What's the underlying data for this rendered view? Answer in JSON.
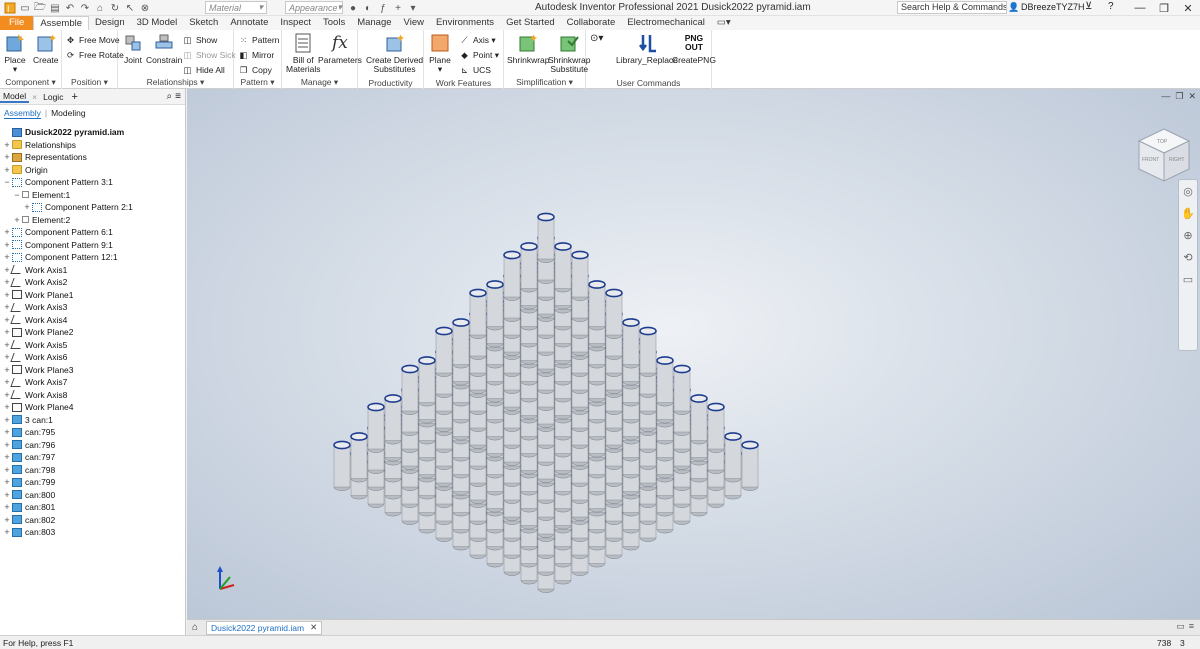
{
  "app": {
    "title": "Autodesk Inventor Professional 2021   Dusick2022 pyramid.iam",
    "search_placeholder": "Search Help & Commands...",
    "user": "DBreezeTYZ7H",
    "material_placeholder": "Material",
    "appearance_placeholder": "Appearance"
  },
  "ribbon_tabs": [
    "File",
    "Assemble",
    "Design",
    "3D Model",
    "Sketch",
    "Annotate",
    "Inspect",
    "Tools",
    "Manage",
    "View",
    "Environments",
    "Get Started",
    "Collaborate",
    "Electromechanical"
  ],
  "ribbon": {
    "component": {
      "title": "Component",
      "place": "Place",
      "create": "Create"
    },
    "position": {
      "title": "Position",
      "free_move": "Free Move",
      "free_rotate": "Free Rotate"
    },
    "relationships": {
      "title": "Relationships",
      "joint": "Joint",
      "constrain": "Constrain",
      "show": "Show",
      "show_sick": "Show Sick",
      "hide_all": "Hide All"
    },
    "pattern": {
      "title": "Pattern",
      "pattern": "Pattern",
      "mirror": "Mirror",
      "copy": "Copy"
    },
    "manage": {
      "title": "Manage",
      "bom_line1": "Bill of",
      "bom_line2": "Materials",
      "parameters": "Parameters"
    },
    "productivity": {
      "title": "Productivity",
      "cds_line1": "Create Derived",
      "cds_line2": "Substitutes"
    },
    "work_features": {
      "title": "Work Features",
      "plane": "Plane",
      "axis": "Axis",
      "point": "Point",
      "ucs": "UCS"
    },
    "simplification": {
      "title": "Simplification",
      "shrinkwrap": "Shrinkwrap",
      "sws_line1": "Shrinkwrap",
      "sws_line2": "Substitute"
    },
    "user_commands": {
      "title": "User Commands",
      "library_replace": "Library_Replace",
      "create_png": "CreatePNG",
      "png_icon_line1": "PNG",
      "png_icon_line2": "OUT"
    }
  },
  "browser": {
    "tabs": [
      "Model",
      "Logic"
    ],
    "subtabs": [
      "Assembly",
      "Modeling"
    ],
    "tree": [
      {
        "label": "Dusick2022 pyramid.iam",
        "icon": "assembly-icon",
        "level": 0,
        "exp": ""
      },
      {
        "label": "Relationships",
        "icon": "folder-icon",
        "level": 0,
        "exp": "+"
      },
      {
        "label": "Representations",
        "icon": "representations-icon",
        "level": 0,
        "exp": "+"
      },
      {
        "label": "Origin",
        "icon": "folder-icon",
        "level": 0,
        "exp": "+"
      },
      {
        "label": "Component Pattern 3:1",
        "icon": "pattern-icon",
        "level": 0,
        "exp": "−"
      },
      {
        "label": "Element:1",
        "icon": "element-icon",
        "level": 1,
        "exp": "−"
      },
      {
        "label": "Component Pattern 2:1",
        "icon": "pattern-icon",
        "level": 2,
        "exp": "+"
      },
      {
        "label": "Element:2",
        "icon": "element-icon",
        "level": 1,
        "exp": "+"
      },
      {
        "label": "Component Pattern 6:1",
        "icon": "pattern-icon",
        "level": 0,
        "exp": "+"
      },
      {
        "label": "Component Pattern 9:1",
        "icon": "pattern-icon",
        "level": 0,
        "exp": "+"
      },
      {
        "label": "Component Pattern 12:1",
        "icon": "pattern-icon",
        "level": 0,
        "exp": "+"
      },
      {
        "label": "Work Axis1",
        "icon": "work-axis-icon",
        "level": 0,
        "exp": "+"
      },
      {
        "label": "Work Axis2",
        "icon": "work-axis-icon",
        "level": 0,
        "exp": "+"
      },
      {
        "label": "Work Plane1",
        "icon": "work-plane-icon",
        "level": 0,
        "exp": "+"
      },
      {
        "label": "Work Axis3",
        "icon": "work-axis-icon",
        "level": 0,
        "exp": "+"
      },
      {
        "label": "Work Axis4",
        "icon": "work-axis-icon",
        "level": 0,
        "exp": "+"
      },
      {
        "label": "Work Plane2",
        "icon": "work-plane-icon",
        "level": 0,
        "exp": "+"
      },
      {
        "label": "Work Axis5",
        "icon": "work-axis-icon",
        "level": 0,
        "exp": "+"
      },
      {
        "label": "Work Axis6",
        "icon": "work-axis-icon",
        "level": 0,
        "exp": "+"
      },
      {
        "label": "Work Plane3",
        "icon": "work-plane-icon",
        "level": 0,
        "exp": "+"
      },
      {
        "label": "Work Axis7",
        "icon": "work-axis-icon",
        "level": 0,
        "exp": "+"
      },
      {
        "label": "Work Axis8",
        "icon": "work-axis-icon",
        "level": 0,
        "exp": "+"
      },
      {
        "label": "Work Plane4",
        "icon": "work-plane-icon",
        "level": 0,
        "exp": "+"
      },
      {
        "label": "3 can:1",
        "icon": "part-icon",
        "level": 0,
        "exp": "+"
      },
      {
        "label": "can:795",
        "icon": "part-icon",
        "level": 0,
        "exp": "+"
      },
      {
        "label": "can:796",
        "icon": "part-icon",
        "level": 0,
        "exp": "+"
      },
      {
        "label": "can:797",
        "icon": "part-icon",
        "level": 0,
        "exp": "+"
      },
      {
        "label": "can:798",
        "icon": "part-icon",
        "level": 0,
        "exp": "+"
      },
      {
        "label": "can:799",
        "icon": "part-icon",
        "level": 0,
        "exp": "+"
      },
      {
        "label": "can:800",
        "icon": "part-icon",
        "level": 0,
        "exp": "+"
      },
      {
        "label": "can:801",
        "icon": "part-icon",
        "level": 0,
        "exp": "+"
      },
      {
        "label": "can:802",
        "icon": "part-icon",
        "level": 0,
        "exp": "+"
      },
      {
        "label": "can:803",
        "icon": "part-icon",
        "level": 0,
        "exp": "+"
      }
    ]
  },
  "viewcube": {
    "top": "TOP",
    "front": "FRONT",
    "right": "RIGHT"
  },
  "pyramid": {
    "levels": 7,
    "top_layer_label": "single can apex"
  },
  "doc_tab": {
    "label": "Dusick2022 pyramid.iam"
  },
  "status": {
    "help": "For Help, press F1",
    "num1": "738",
    "num2": "3"
  },
  "colors": {
    "file_tab": "#f28c1e",
    "accent": "#1e6fc6",
    "can_body": "#d4d7dc",
    "can_rim": "#1f3d8f"
  }
}
